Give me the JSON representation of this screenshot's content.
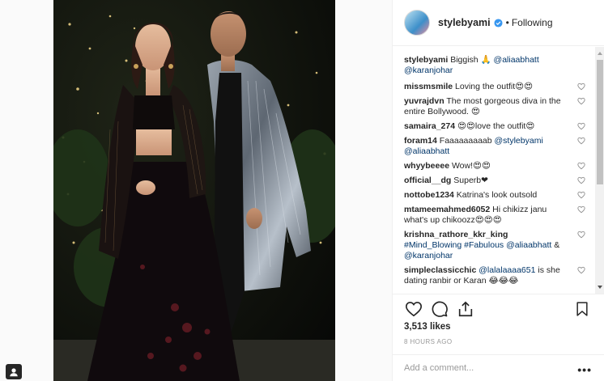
{
  "post": {
    "username": "stylebyami",
    "dot": "•",
    "follow_state": "Following",
    "likes": "3,513 likes",
    "timestamp": "8 HOURS AGO",
    "add_comment_placeholder": "Add a comment...",
    "more_label": "•••"
  },
  "comments": [
    {
      "user": "stylebyami",
      "parts": [
        {
          "t": " Biggish 🙏 ",
          "m": false
        },
        {
          "t": "@aliaabhatt @karanjohar",
          "m": true
        }
      ],
      "heart": false
    },
    {
      "user": "missmsmile",
      "parts": [
        {
          "t": " Loving the outfit😍😍",
          "m": false
        }
      ],
      "heart": true
    },
    {
      "user": "yuvrajdvn",
      "parts": [
        {
          "t": " The most gorgeous diva in the entire Bollywood. 😍",
          "m": false
        }
      ],
      "heart": true
    },
    {
      "user": "samaira_274",
      "parts": [
        {
          "t": " 😍😍love the outfit😍",
          "m": false
        }
      ],
      "heart": true
    },
    {
      "user": "foram14",
      "parts": [
        {
          "t": " Faaaaaaaaab ",
          "m": false
        },
        {
          "t": "@stylebyami @aliaabhatt",
          "m": true
        }
      ],
      "heart": true
    },
    {
      "user": "whyybeeee",
      "parts": [
        {
          "t": " Wow!😍😍",
          "m": false
        }
      ],
      "heart": true
    },
    {
      "user": "official__dg",
      "parts": [
        {
          "t": " Superb❤",
          "m": false
        }
      ],
      "heart": true
    },
    {
      "user": "nottobe1234",
      "parts": [
        {
          "t": " Katrina's look outsold",
          "m": false
        }
      ],
      "heart": true
    },
    {
      "user": "mtameemahmed6052",
      "parts": [
        {
          "t": " Hi chikizz janu what's up chikoozz😍😍😍",
          "m": false
        }
      ],
      "heart": true
    },
    {
      "user": "krishna_rathore_kkr_king",
      "parts": [
        {
          "t": " #Mind_Blowing #Fabulous @aliaabhatt",
          "m": true
        },
        {
          "t": " & ",
          "m": false
        },
        {
          "t": "@karanjohar",
          "m": true
        }
      ],
      "heart": true
    },
    {
      "user": "simpleclassicchic",
      "parts": [
        {
          "t": " ",
          "m": false
        },
        {
          "t": "@lalalaaaa651",
          "m": true
        },
        {
          "t": " is she dating ranbir or Karan 😂😂😂",
          "m": false
        }
      ],
      "heart": true
    }
  ],
  "colors": {
    "mention": "#003569",
    "text": "#262626",
    "muted": "#999999",
    "verified": "#3897f0"
  },
  "icons": {
    "like": "heart-outline-icon",
    "comment": "speech-bubble-icon",
    "share": "share-upload-icon",
    "save": "bookmark-icon",
    "comment_like": "small-heart-icon",
    "verified": "verified-badge-icon",
    "corner": "contact-card-icon"
  }
}
